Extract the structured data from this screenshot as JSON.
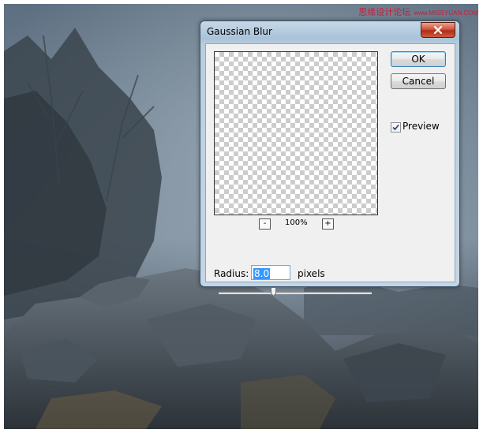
{
  "watermark": {
    "cn": "思缘设计论坛",
    "site": "www.MISSYUAN.COM"
  },
  "dialog": {
    "title": "Gaussian Blur",
    "ok_label": "OK",
    "cancel_label": "Cancel",
    "preview_label": "Preview",
    "preview_checked": true,
    "zoom_out_label": "-",
    "zoom_in_label": "+",
    "zoom_level": "100%",
    "radius_label": "Radius:",
    "radius_value": "8.0",
    "radius_unit": "pixels",
    "radius_slider_fraction": 0.36
  },
  "colors": {
    "close_button": "#c9462c",
    "accent_focus": "#3399ff"
  },
  "icons": {
    "close": "close-x-icon",
    "check": "check-icon"
  }
}
